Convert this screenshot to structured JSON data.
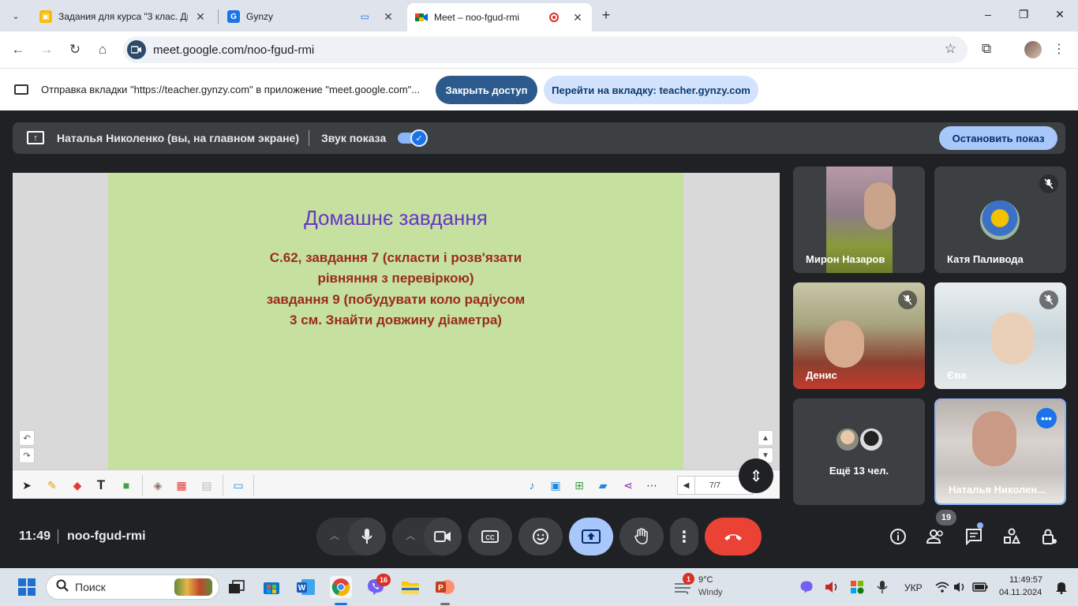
{
  "browser": {
    "tabs": [
      {
        "title": "Задания для курса \"3 клас. Ди",
        "close": "✕"
      },
      {
        "title": "Gynzy",
        "close": "✕"
      },
      {
        "title": "Meet – noo-fgud-rmi",
        "close": "✕"
      }
    ],
    "new_tab": "+",
    "url": "meet.google.com/noo-fgud-rmi"
  },
  "infobar": {
    "text": "Отправка вкладки \"https://teacher.gynzy.com\" в приложение \"meet.google.com\"...",
    "close_access": "Закрыть доступ",
    "goto_tab": "Перейти на вкладку: teacher.gynzy.com"
  },
  "presenting": {
    "presenter": "Наталья Николенко (вы, на главном экране)",
    "sound_label": "Звук показа",
    "sound_on": true,
    "stop_button": "Остановить показ"
  },
  "slide": {
    "title": "Домашнє завдання",
    "lines": [
      "С.62, завдання 7 (скласти і розв'язати",
      "рівняння з  перевіркою)",
      "завдання 9 (побудувати коло радіусом",
      "3 см. Знайти довжину діаметра)"
    ],
    "page": "7/7"
  },
  "participants": [
    {
      "name": "Мирон Назаров",
      "muted": false
    },
    {
      "name": "Катя Паливода",
      "muted": true
    },
    {
      "name": "Денис",
      "muted": true
    },
    {
      "name": "Єва",
      "muted": true
    },
    {
      "name": "Ещё 13 чел."
    },
    {
      "name": "Наталья Николен..."
    }
  ],
  "meeting": {
    "time": "11:49",
    "code": "noo-fgud-rmi",
    "people_count": "19"
  },
  "taskbar": {
    "search": "Поиск",
    "weather_temp": "9°C",
    "weather_desc": "Windy",
    "weather_badge": "1",
    "viber_badge": "16",
    "lang": "УКР",
    "time": "11:49:57",
    "date": "04.11.2024"
  },
  "colors": {
    "meet_bg": "#202124",
    "tile_bg": "#3c4043",
    "slide_bg": "#c5e09f",
    "slide_title": "#6636c8",
    "slide_text": "#9b2a1d",
    "end_call": "#ea4335",
    "accent_blue": "#a8c7fa"
  }
}
